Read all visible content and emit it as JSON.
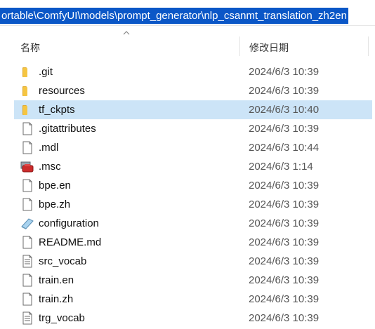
{
  "address": {
    "path": "ortable\\ComfyUI\\models\\prompt_generator\\nlp_csanmt_translation_zh2en"
  },
  "columns": {
    "name": "名称",
    "date_modified": "修改日期"
  },
  "files": [
    {
      "name": ".git",
      "date": "2024/6/3 10:39",
      "icon": "folder-icon"
    },
    {
      "name": "resources",
      "date": "2024/6/3 10:39",
      "icon": "folder-icon"
    },
    {
      "name": "tf_ckpts",
      "date": "2024/6/3 10:40",
      "icon": "folder-icon"
    },
    {
      "name": ".gitattributes",
      "date": "2024/6/3 10:39",
      "icon": "file-icon"
    },
    {
      "name": ".mdl",
      "date": "2024/6/3 10:44",
      "icon": "file-icon"
    },
    {
      "name": ".msc",
      "date": "2024/6/3 1:14",
      "icon": "msc-icon"
    },
    {
      "name": "bpe.en",
      "date": "2024/6/3 10:39",
      "icon": "file-icon"
    },
    {
      "name": "bpe.zh",
      "date": "2024/6/3 10:39",
      "icon": "file-icon"
    },
    {
      "name": "configuration",
      "date": "2024/6/3 10:39",
      "icon": "config-icon"
    },
    {
      "name": "README.md",
      "date": "2024/6/3 10:39",
      "icon": "file-icon"
    },
    {
      "name": "src_vocab",
      "date": "2024/6/3 10:39",
      "icon": "text-file-icon"
    },
    {
      "name": "train.en",
      "date": "2024/6/3 10:39",
      "icon": "file-icon"
    },
    {
      "name": "train.zh",
      "date": "2024/6/3 10:39",
      "icon": "file-icon"
    },
    {
      "name": "trg_vocab",
      "date": "2024/6/3 10:39",
      "icon": "text-file-icon"
    }
  ],
  "selected_index": 2,
  "colors": {
    "selection_bg": "#cce4f7",
    "address_highlight": "#0b57c7",
    "folder_yellow": "#f5c542"
  }
}
